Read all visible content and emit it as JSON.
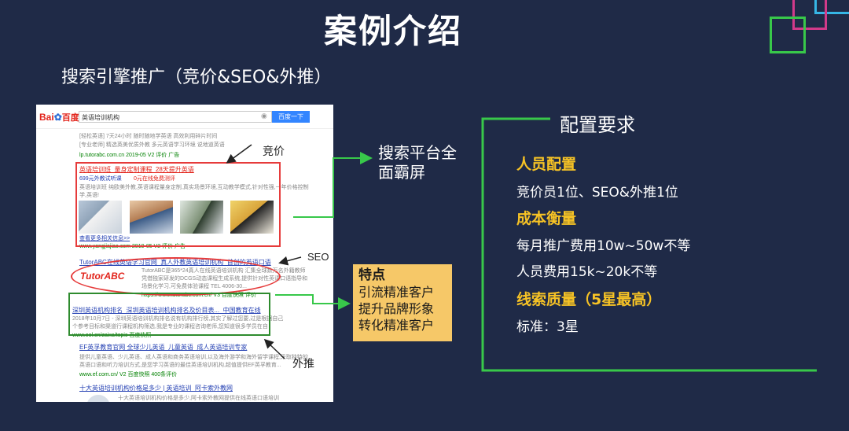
{
  "page": {
    "title": "案例介绍",
    "subtitle": "搜索引擎推广（竞价&SEO&外推）"
  },
  "screenshot": {
    "logo": {
      "bai": "Bai",
      "du": "百度"
    },
    "search_value": "英语培训机构",
    "search_button": "百度一下",
    "lines": [
      "[轻松英语] 7天24小时 随时随地学英语 高效利用碎片时间",
      "[专业老师] 精选英美优质外教 多元英语学习环境 说地道英语",
      "lp.tutorabc.com.cn  2019-05  V2  评价  广告",
      "英语培训班_量身定制课程_28天提升英语",
      "699元外教试听课",
      "0元在线免费测评",
      "英语培训班 纯欧美外教,英语课程量身定制,真实场景环境,互动教学模式,针对性强,一年价格控制",
      "学,英语!",
      "查看更多相关信息>>",
      "www.yangjiajiao.com  2019-05  V2  评价  广告",
      "TutorABC在线英语学习官网_真人外教英语培训机构_首创的英语口语",
      "TutorABC是365*24真人在线英语培训机构 汇集全球数万名外籍教师",
      "凭借独家研发的DCGS动态课程生成系统,提供针对性英语口语指导和",
      "场景化学习,可免费体验课程 TEL 4006-30...",
      "https://www.tutorabc.com.cn/  V3  百度快照  评价",
      "深圳英语机构排名_深圳英语培训机构排名及价目表..._中国教育在线",
      "2018年10月7日 - 深圳英语培训机构排名说有机构排行榜,其实了解过您要,过是根据自己",
      "个参考目标和渠道行课程机构筛选,我是专业的课程咨询老师,您知道很多学员在自",
      "www.eol.cn/zaixa/topic  百度快照",
      "EF英孚教育官网 全球少儿英语_儿童英语_成人英语培训专家",
      "提供儿童英语、少儿英语、成人英语和商务英语培训,以及海外游学和海外留学课程,采取独特的",
      "英语口语和听力培训方式,是您学习英语的最佳英语培训机构,超值提供EF英孚教育...",
      "www.ef.com.cn/  V2  百度快照  400条评价",
      "十大英语培训机构价格是多少 | 英语培训_阿卡索外教网",
      "十大英语培训机构价格是多少,阿卡索外教网提供在线英语口语培训"
    ],
    "tutor_logo": "TutorABC"
  },
  "annotations": {
    "jingjia": "竞价",
    "seo": "SEO",
    "waitui": "外推",
    "callout": [
      "搜索平台全",
      "面霸屏"
    ]
  },
  "features": {
    "title": "特点",
    "items": [
      "引流精准客户",
      "提升品牌形象",
      "转化精准客户"
    ]
  },
  "config": {
    "title": "配置要求",
    "sections": [
      {
        "heading": "人员配置",
        "lines": [
          "竞价员1位、SEO&外推1位"
        ]
      },
      {
        "heading": "成本衡量",
        "lines": [
          "每月推广费用10w~50w不等",
          "人员费用15k~20k不等"
        ]
      },
      {
        "heading": "线索质量（5星最高）",
        "lines": [
          "标准：3星"
        ]
      }
    ]
  },
  "colors": {
    "background": "#1f2a47",
    "accent_green": "#38c84a",
    "accent_yellow": "#f7c325",
    "feature_box": "#f6c868",
    "highlight_red": "#e63b3b"
  }
}
